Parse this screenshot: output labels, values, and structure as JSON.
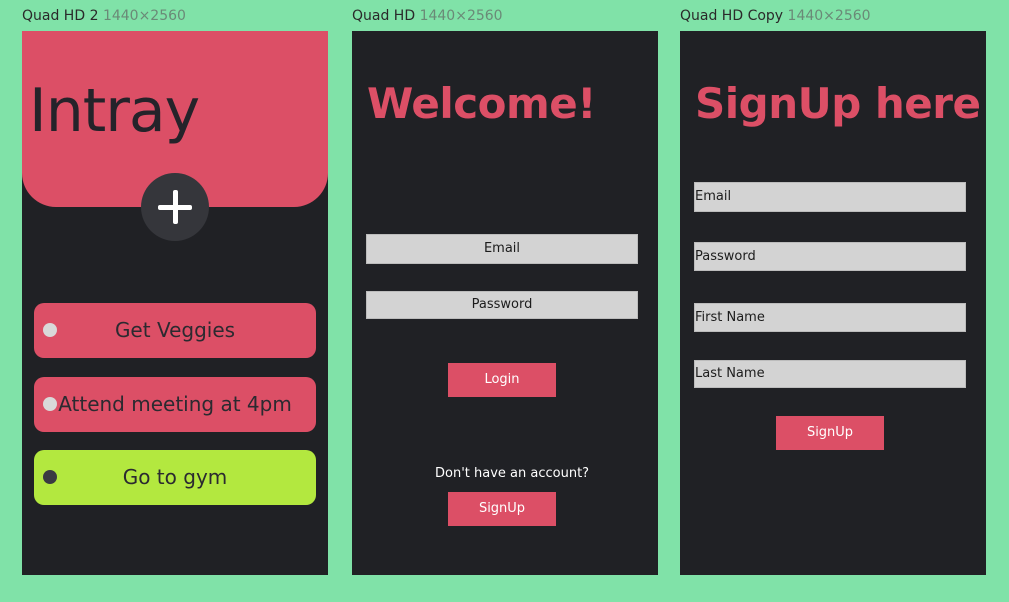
{
  "artboards": [
    {
      "name": "Quad HD 2",
      "size": "1440×2560"
    },
    {
      "name": "Quad HD",
      "size": "1440×2560"
    },
    {
      "name": "Quad HD Copy",
      "size": "1440×2560"
    }
  ],
  "intray": {
    "title": "Intray",
    "add_icon": "plus-icon",
    "tasks": [
      {
        "label": "Get Veggies",
        "done": false
      },
      {
        "label": "Attend meeting at 4pm",
        "done": false
      },
      {
        "label": "Go to gym",
        "done": true
      }
    ]
  },
  "login": {
    "heading": "Welcome!",
    "email_placeholder": "Email",
    "password_placeholder": "Password",
    "login_label": "Login",
    "no_account_text": "Don't have an account?",
    "signup_label": "SignUp"
  },
  "signup": {
    "heading": "SignUp here!",
    "email_placeholder": "Email",
    "password_placeholder": "Password",
    "first_name_placeholder": "First Name",
    "last_name_placeholder": "Last Name",
    "signup_label": "SignUp"
  },
  "colors": {
    "canvas": "#80e2a8",
    "screen_bg": "#202125",
    "accent": "#dc4f66",
    "done_green": "#b3e83f",
    "field_bg": "#d3d3d3"
  }
}
